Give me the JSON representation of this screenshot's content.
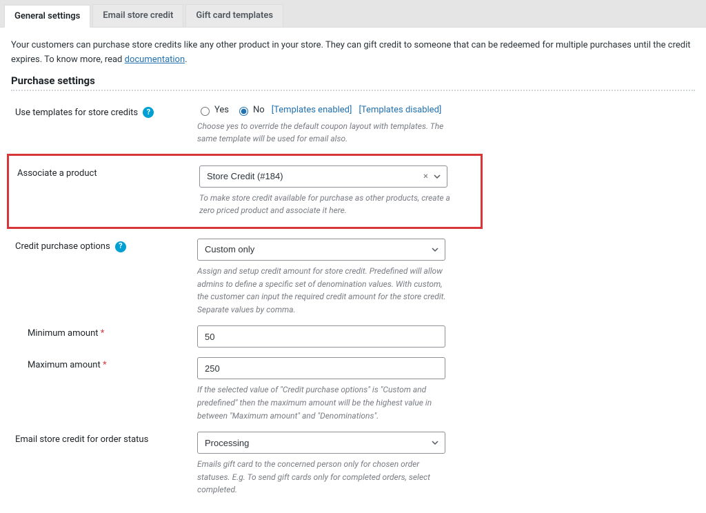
{
  "tabs": {
    "general": "General settings",
    "email": "Email store credit",
    "gift": "Gift card templates"
  },
  "intro": {
    "text": "Your customers can purchase store credits like any other product in your store. They can gift credit to someone that can be redeemed for multiple purchases until the credit expires. To know more, read ",
    "link": "documentation",
    "suffix": "."
  },
  "section_title": "Purchase settings",
  "use_templates": {
    "label": "Use templates for store credits",
    "yes": "Yes",
    "no": "No",
    "enabled": "[Templates enabled]",
    "disabled": "[Templates disabled]",
    "desc": "Choose yes to override the default coupon layout with templates. The same template will be used for email also."
  },
  "associate": {
    "label": "Associate a product",
    "value": "Store Credit (#184)",
    "desc": "To make store credit available for purchase as other products, create a zero priced product and associate it here."
  },
  "purchase_options": {
    "label": "Credit purchase options",
    "value": "Custom only",
    "desc": "Assign and setup credit amount for store credit. Predefined will allow admins to define a specific set of denomination values. With custom, the customer can input the required credit amount for the store credit. Separate values by comma."
  },
  "min_amount": {
    "label": "Minimum amount",
    "value": "50"
  },
  "max_amount": {
    "label": "Maximum amount",
    "value": "250",
    "desc": "If the selected value of \"Credit purchase options\" is \"Custom and predefined\" then the maximum amount will be the highest value in between \"Maximum amount\" and \"Denominations\"."
  },
  "email_status": {
    "label": "Email store credit for order status",
    "value": "Processing",
    "desc": "Emails gift card to the concerned person only for chosen order statuses. E.g. To send gift cards only for completed orders, select completed."
  }
}
